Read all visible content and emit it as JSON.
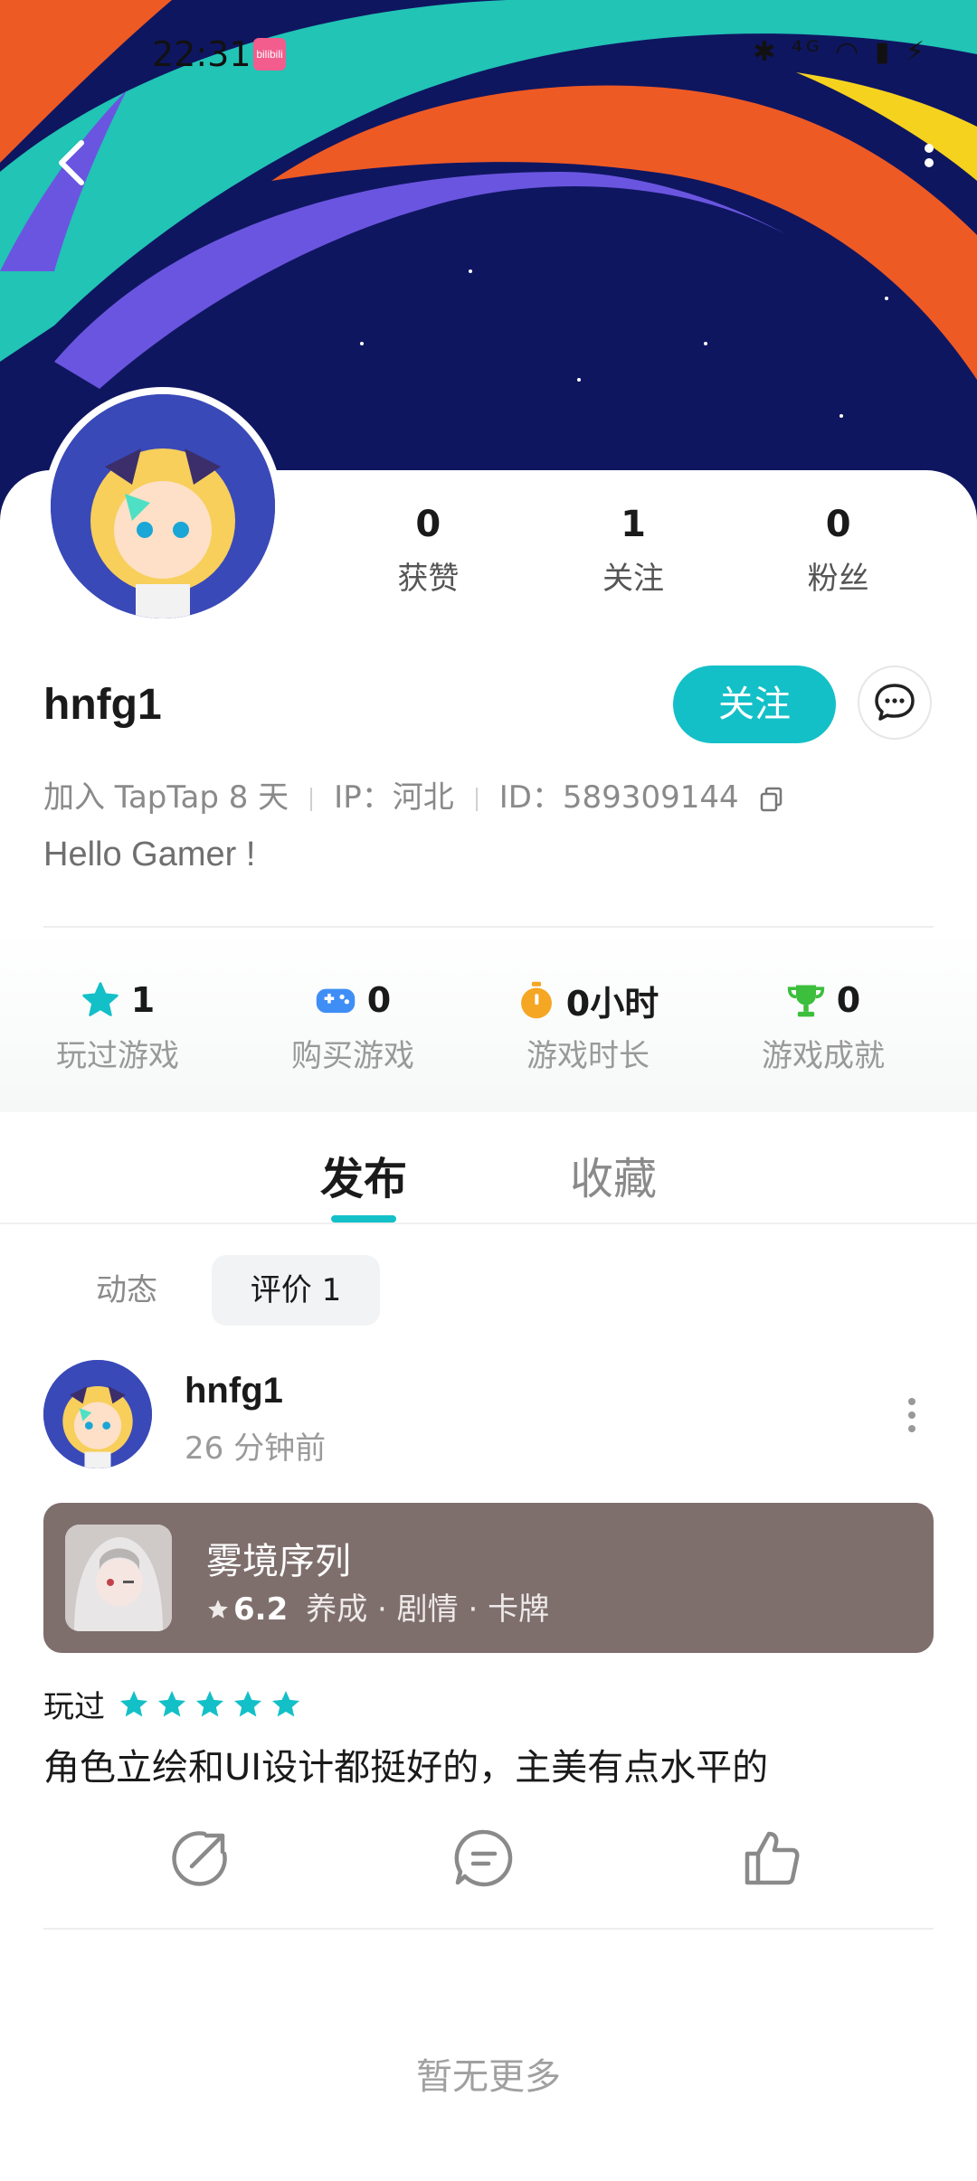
{
  "status_bar": {
    "time": "22:31",
    "app_icon_label": "bilibili",
    "right_icons": "✱ ⁴ᴳ ◠ ▮ ⚡"
  },
  "header": {
    "back_icon": "chevron-left-icon",
    "more_icon": "more-vertical-icon"
  },
  "profile": {
    "stats": [
      {
        "value": "0",
        "label": "获赞"
      },
      {
        "value": "1",
        "label": "关注"
      },
      {
        "value": "0",
        "label": "粉丝"
      }
    ],
    "username": "hnfg1",
    "follow_label": "关注",
    "joined": "加入 TapTap 8 天",
    "ip": "IP：河北",
    "id": "ID：589309144",
    "bio": "Hello Gamer !"
  },
  "game_stats": [
    {
      "value": "1",
      "label": "玩过游戏",
      "icon": "star-icon",
      "color": "#14c0c8"
    },
    {
      "value": "0",
      "label": "购买游戏",
      "icon": "gamepad-icon",
      "color": "#3f8ef5"
    },
    {
      "value": "0小时",
      "label": "游戏时长",
      "icon": "stopwatch-icon",
      "color": "#f5a623"
    },
    {
      "value": "0",
      "label": "游戏成就",
      "icon": "trophy-icon",
      "color": "#3cbf3c"
    }
  ],
  "tabs": [
    {
      "label": "发布",
      "active": true
    },
    {
      "label": "收藏",
      "active": false
    }
  ],
  "subtabs": [
    {
      "label": "动态",
      "active": false
    },
    {
      "label": "评价 1",
      "active": true
    }
  ],
  "post": {
    "username": "hnfg1",
    "time": "26 分钟前",
    "game": {
      "name": "雾境序列",
      "score": "6.2",
      "tags": "养成 · 剧情 · 卡牌"
    },
    "played_label": "玩过",
    "rating": 5,
    "review": "角色立绘和UI设计都挺好的，主美有点水平的"
  },
  "footer": {
    "no_more": "暂无更多"
  },
  "colors": {
    "accent": "#14c0c8",
    "banner_bg": "#0f1660"
  }
}
